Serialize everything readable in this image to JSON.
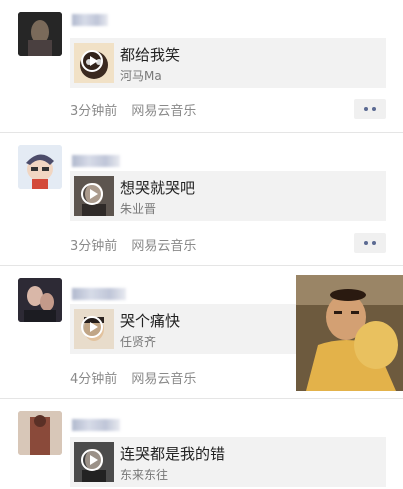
{
  "posts": [
    {
      "song": "都给我笑",
      "artist": "河马Ma",
      "time": "3分钟前",
      "source": "网易云音乐"
    },
    {
      "song": "想哭就哭吧",
      "artist": "朱业晋",
      "time": "3分钟前",
      "source": "网易云音乐"
    },
    {
      "song": "哭个痛快",
      "artist": "任贤齐",
      "time": "4分钟前",
      "source": "网易云音乐"
    },
    {
      "song": "连哭都是我的错",
      "artist": "东来东往",
      "time": "",
      "source": ""
    }
  ],
  "icons": {
    "play": "play-icon",
    "more": "more-dots-icon"
  },
  "colors": {
    "link": "#5b6a92",
    "card_bg": "#f2f2f2",
    "meta_text": "#8a8a8a"
  }
}
